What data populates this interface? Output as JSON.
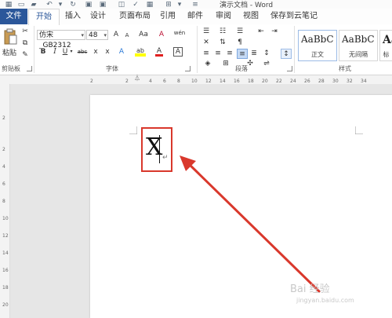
{
  "window": {
    "title": "演示文档 - Word"
  },
  "tabs": [
    {
      "label": "文件"
    },
    {
      "label": "开始"
    },
    {
      "label": "插入"
    },
    {
      "label": "设计"
    },
    {
      "label": "页面布局"
    },
    {
      "label": "引用"
    },
    {
      "label": "邮件"
    },
    {
      "label": "审阅"
    },
    {
      "label": "视图"
    },
    {
      "label": "保存到云笔记"
    }
  ],
  "ribbon": {
    "clipboard": {
      "paste_label": "粘贴",
      "group_label": "剪贴板"
    },
    "font": {
      "font_name": "仿宋_GB2312",
      "font_size": "48",
      "group_label": "字体",
      "grow": "A",
      "shrink": "A",
      "case": "Aa",
      "clear": "A",
      "phonetic": "wén",
      "bold": "B",
      "italic": "I",
      "underline": "U",
      "strike": "abc",
      "subscript": "x",
      "superscript": "x",
      "text_effect": "A",
      "highlight": "ab",
      "font_color": "A",
      "char_border": "A"
    },
    "paragraph": {
      "group_label": "段落"
    },
    "styles": {
      "group_label": "样式",
      "items": [
        {
          "sample": "AaBbC",
          "name": "正文"
        },
        {
          "sample": "AaBbC",
          "name": "无间隔"
        },
        {
          "sample": "Aa",
          "name": "标"
        }
      ]
    }
  },
  "ruler": {
    "h_ticks": [
      "2",
      "2",
      "4",
      "6",
      "8",
      "10",
      "12",
      "14",
      "16",
      "18",
      "20",
      "22",
      "24",
      "26",
      "28",
      "30",
      "32",
      "34"
    ],
    "v_ticks": [
      "2",
      "2",
      "4",
      "6",
      "8",
      "10",
      "12",
      "14",
      "16",
      "18",
      "20"
    ]
  },
  "document": {
    "content": "X",
    "paragraph_mark": "↵"
  },
  "watermark": {
    "line1": "Bai 经验",
    "line2": "jingyan.baidu.com"
  },
  "colors": {
    "file_tab": "#2b579a",
    "annotation": "#d9382c"
  }
}
